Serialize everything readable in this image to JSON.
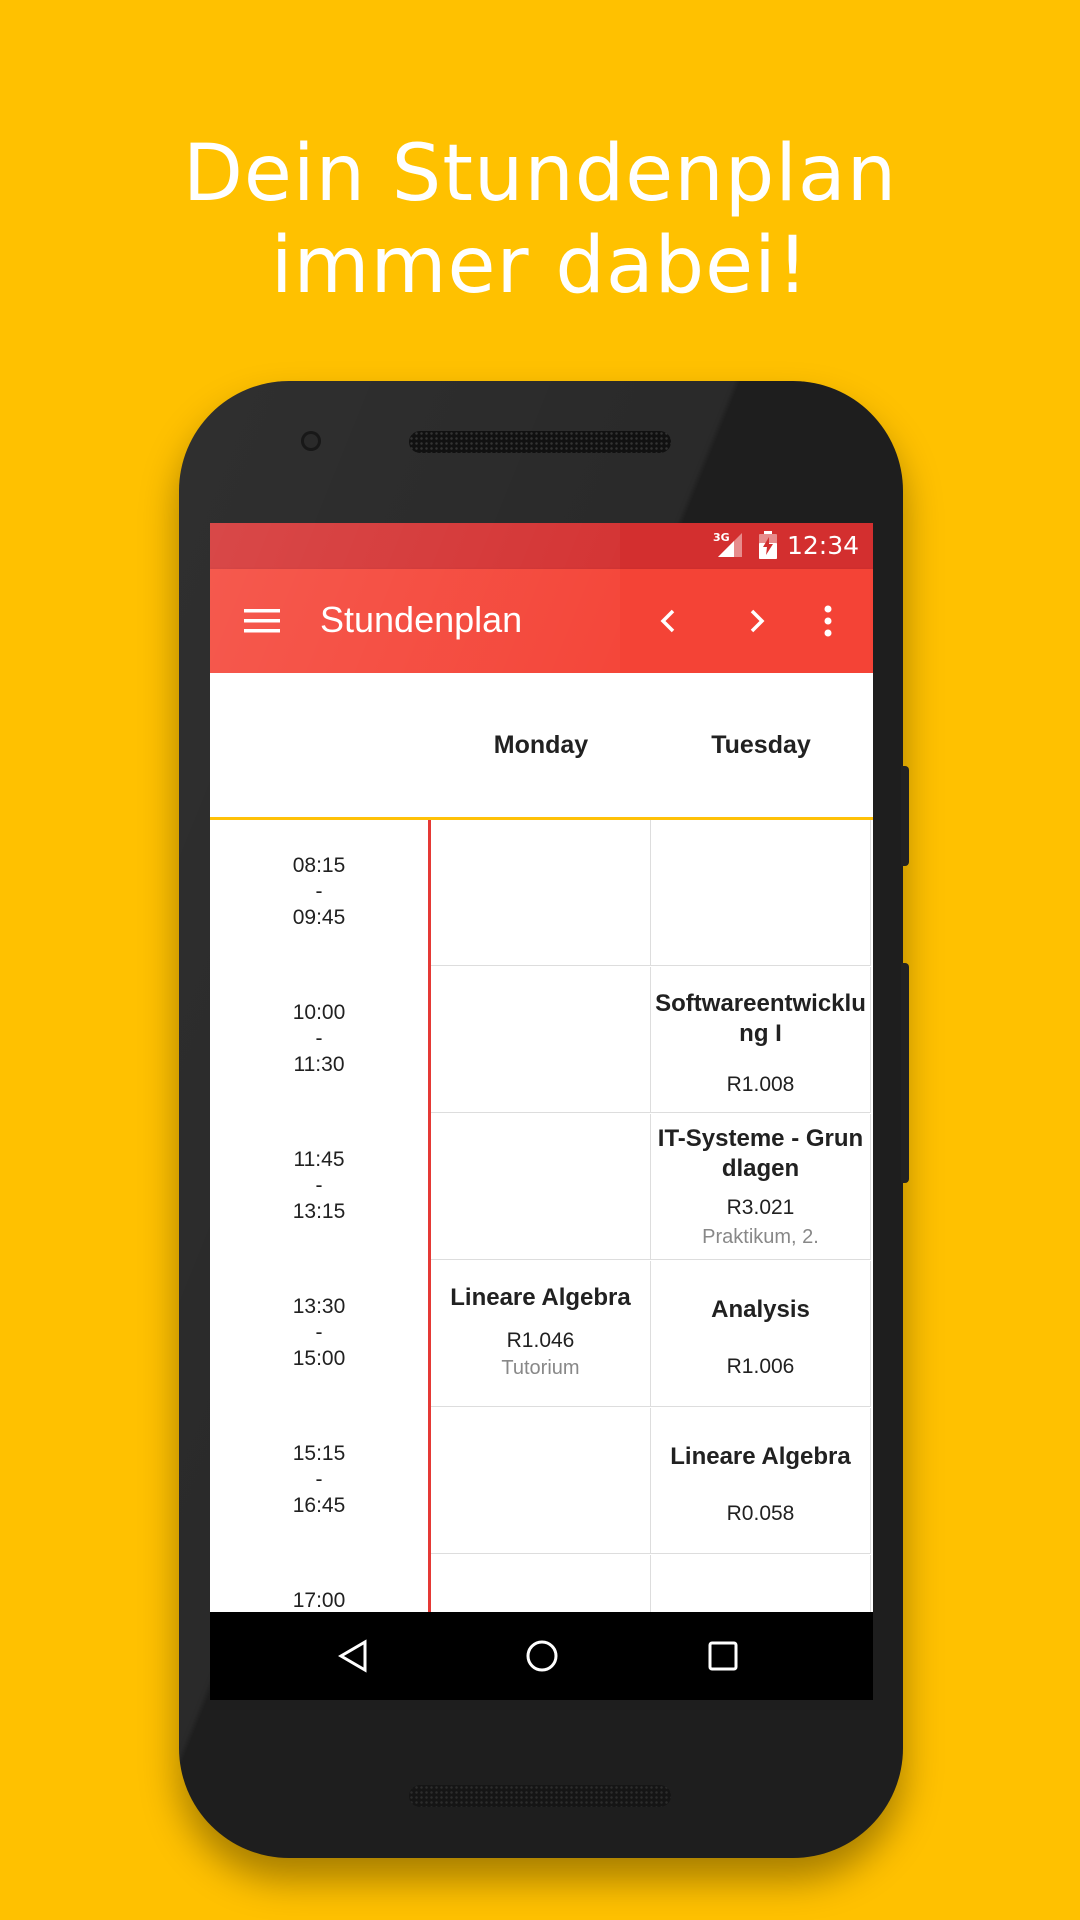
{
  "headline": {
    "line1": "Dein Stundenplan",
    "line2": "immer dabei!"
  },
  "status_bar": {
    "network": "3G",
    "time": "12:34"
  },
  "app_bar": {
    "title": "Stundenplan"
  },
  "days": [
    "Monday",
    "Tuesday"
  ],
  "time_slots": [
    {
      "start": "08:15",
      "sep": "-",
      "end": "09:45"
    },
    {
      "start": "10:00",
      "sep": "-",
      "end": "11:30"
    },
    {
      "start": "11:45",
      "sep": "-",
      "end": "13:15"
    },
    {
      "start": "13:30",
      "sep": "-",
      "end": "15:00"
    },
    {
      "start": "15:15",
      "sep": "-",
      "end": "16:45"
    },
    {
      "start": "17:00",
      "sep": "",
      "end": ""
    }
  ],
  "courses": {
    "tue_1": {
      "title": "Softwareentwicklung I",
      "room": "R1.008",
      "type": ""
    },
    "tue_2": {
      "title": "IT-Systeme - Grundlagen",
      "room": "R3.021",
      "type": "Praktikum, 2."
    },
    "mon_3": {
      "title": "Lineare Algebra",
      "room": "R1.046",
      "type": "Tutorium"
    },
    "tue_3": {
      "title": "Analysis",
      "room": "R1.006",
      "type": ""
    },
    "tue_4": {
      "title": "Lineare Algebra",
      "room": "R0.058",
      "type": ""
    }
  },
  "colors": {
    "background": "#FFC100",
    "status_bar": "#D32F2F",
    "app_bar": "#F44336",
    "accent_line": "#FFC107",
    "time_divider": "#E53935"
  }
}
